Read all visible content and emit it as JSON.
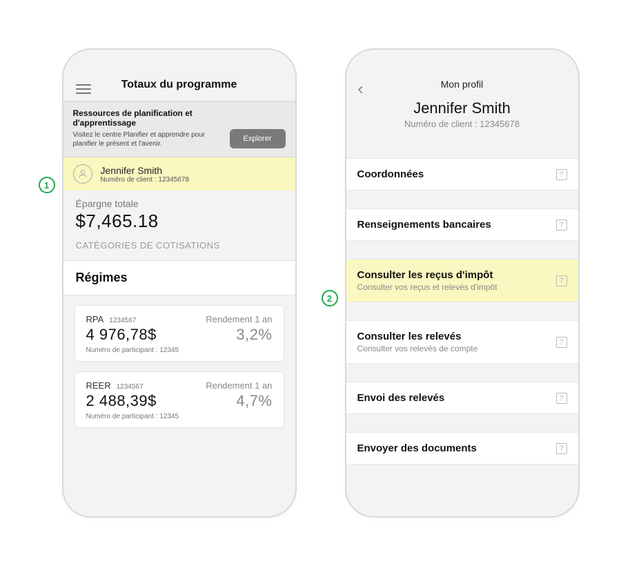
{
  "callouts": {
    "one": "1",
    "two": "2"
  },
  "phone1": {
    "title": "Totaux du programme",
    "banner": {
      "heading": "Ressources de planification et d'apprentissage",
      "sub": "Visitez le centre Planifier et apprendre pour planifier le présent et l'avenir.",
      "button": "Explorer"
    },
    "client": {
      "name": "Jennifer Smith",
      "number": "Numéro de client : 12345678"
    },
    "savings": {
      "label": "Épargne totale",
      "amount": "$7,465.18"
    },
    "categories": "CATÉGORIES DE COTISATIONS",
    "regimes_heading": "Régimes",
    "plans": [
      {
        "code": "RPA",
        "id": "1234567",
        "amount": "4 976,78$",
        "participant": "Numéro de participant : 12345",
        "return_label": "Rendement 1 an",
        "return_value": "3,2%"
      },
      {
        "code": "REER",
        "id": "1234567",
        "amount": "2 488,39$",
        "participant": "Numéro de participant : 12345",
        "return_label": "Rendement 1 an",
        "return_value": "4,7%"
      }
    ]
  },
  "phone2": {
    "title": "Mon profil",
    "name": "Jennifer Smith",
    "number": "Numéro de client : 12345678",
    "rows": [
      {
        "title": "Coordonnées",
        "sub": "",
        "highlight": false
      },
      {
        "title": "Renseignements bancaires",
        "sub": "",
        "highlight": false
      },
      {
        "title": "Consulter les reçus d'impôt",
        "sub": "Consulter vos reçus et relevés d'impôt",
        "highlight": true
      },
      {
        "title": "Consulter les relevés",
        "sub": "Consulter vos relevés de compte",
        "highlight": false
      },
      {
        "title": "Envoi des relevés",
        "sub": "",
        "highlight": false
      },
      {
        "title": "Envoyer des documents",
        "sub": "",
        "highlight": false
      }
    ],
    "help_glyph": "?"
  }
}
